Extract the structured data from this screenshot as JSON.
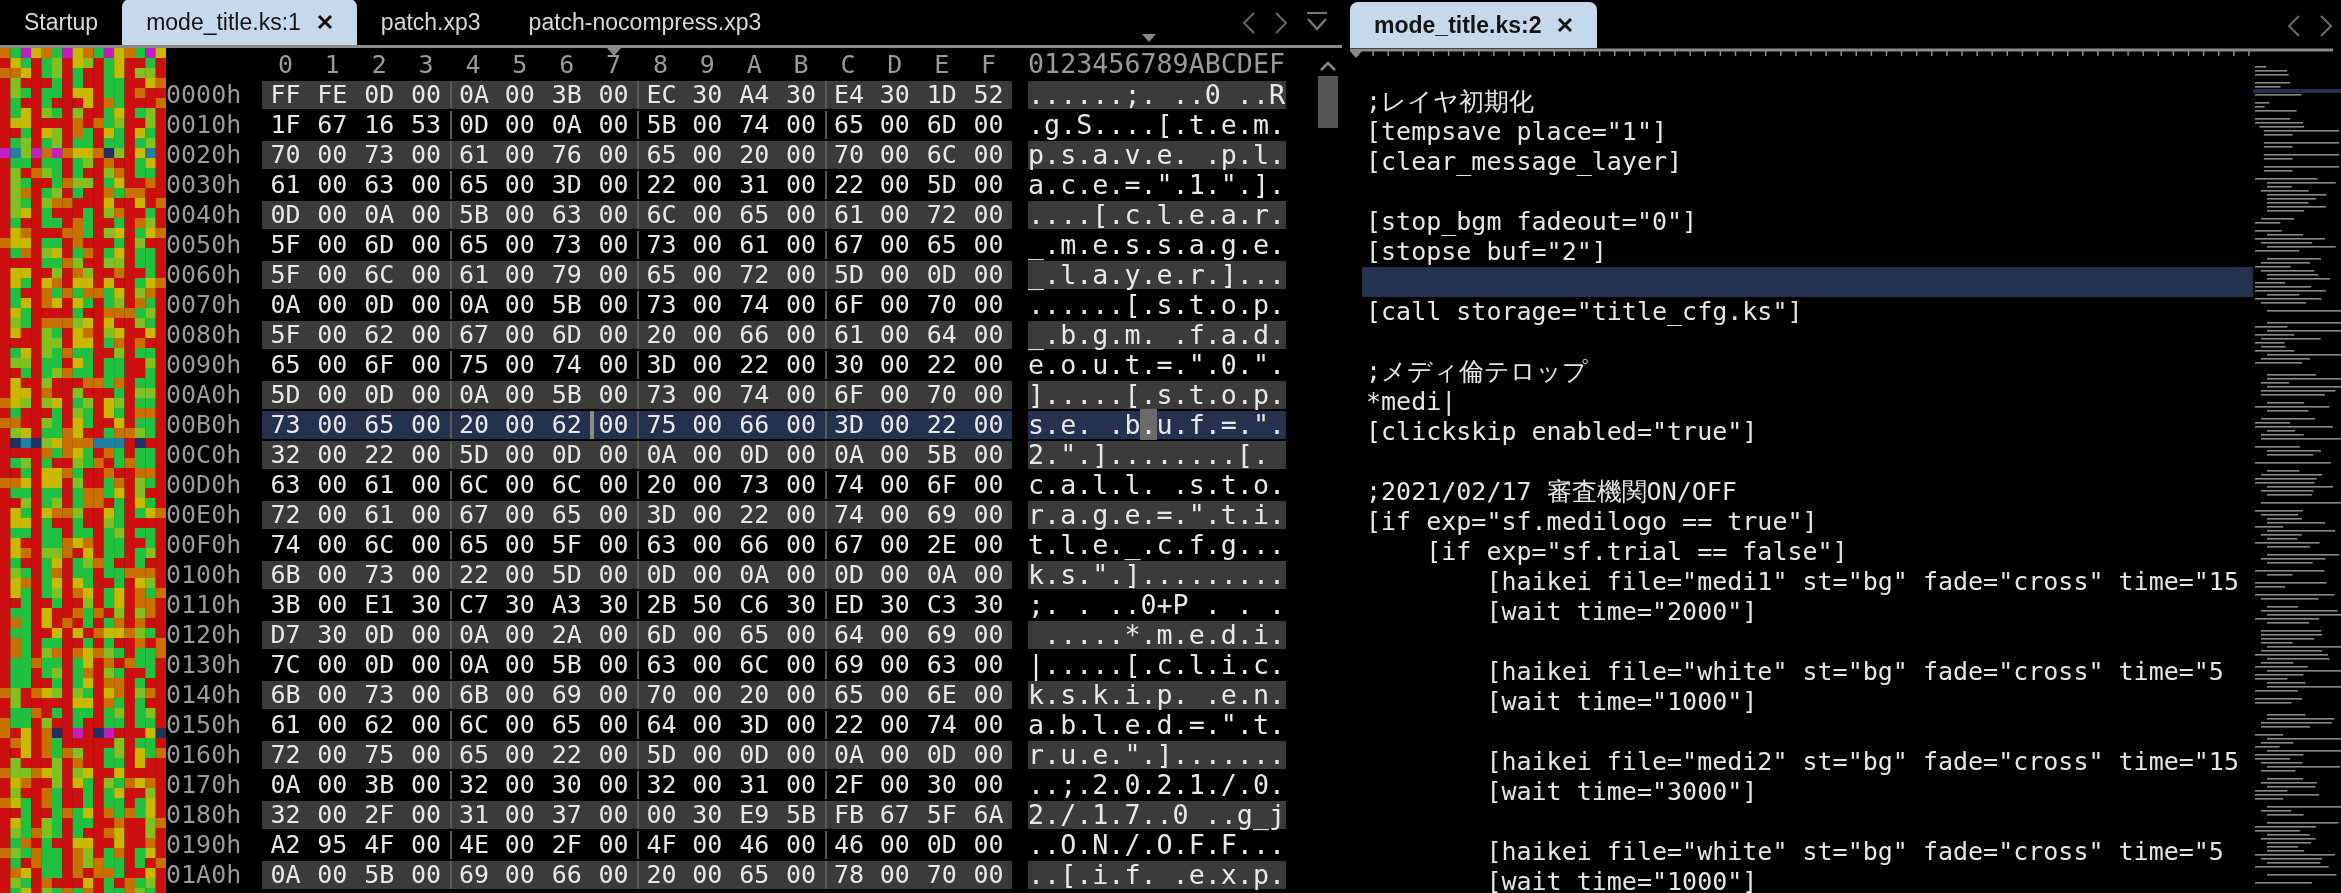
{
  "left_pane": {
    "focused": false,
    "tabs": [
      {
        "label": "Startup",
        "selected": false
      },
      {
        "label": "mode_title.ks:1",
        "selected": true
      },
      {
        "label": "patch.xp3",
        "selected": false
      },
      {
        "label": "patch-nocompress.xp3",
        "selected": false
      }
    ],
    "hex_view": {
      "columns": [
        {
          "label": "0",
          "cursor": false
        },
        {
          "label": "1",
          "cursor": false
        },
        {
          "label": "2",
          "cursor": false
        },
        {
          "label": "3",
          "cursor": false
        },
        {
          "label": "4",
          "cursor": false
        },
        {
          "label": "5",
          "cursor": false
        },
        {
          "label": "6",
          "cursor": false
        },
        {
          "label": "7",
          "cursor": true
        },
        {
          "label": "8",
          "cursor": false
        },
        {
          "label": "9",
          "cursor": false
        },
        {
          "label": "A",
          "cursor": false
        },
        {
          "label": "B",
          "cursor": false
        },
        {
          "label": "C",
          "cursor": false
        },
        {
          "label": "D",
          "cursor": false
        },
        {
          "label": "E",
          "cursor": false
        },
        {
          "label": "F",
          "cursor": false
        }
      ],
      "ascii_header": "0123456789ABCDEF",
      "rows": [
        {
          "offset": "0000h",
          "bytes": [
            "FF",
            "FE",
            "0D",
            "00",
            "0A",
            "00",
            "3B",
            "00",
            "EC",
            "30",
            "A4",
            "30",
            "E4",
            "30",
            "1D",
            "52"
          ],
          "ascii": "......;. ..0 ..R",
          "selected": false
        },
        {
          "offset": "0010h",
          "bytes": [
            "1F",
            "67",
            "16",
            "53",
            "0D",
            "00",
            "0A",
            "00",
            "5B",
            "00",
            "74",
            "00",
            "65",
            "00",
            "6D",
            "00"
          ],
          "ascii": ".g.S....[.t.e.m.",
          "selected": false
        },
        {
          "offset": "0020h",
          "bytes": [
            "70",
            "00",
            "73",
            "00",
            "61",
            "00",
            "76",
            "00",
            "65",
            "00",
            "20",
            "00",
            "70",
            "00",
            "6C",
            "00"
          ],
          "ascii": "p.s.a.v.e. .p.l.",
          "selected": false
        },
        {
          "offset": "0030h",
          "bytes": [
            "61",
            "00",
            "63",
            "00",
            "65",
            "00",
            "3D",
            "00",
            "22",
            "00",
            "31",
            "00",
            "22",
            "00",
            "5D",
            "00"
          ],
          "ascii": "a.c.e.=.\".1.\".].",
          "selected": false
        },
        {
          "offset": "0040h",
          "bytes": [
            "0D",
            "00",
            "0A",
            "00",
            "5B",
            "00",
            "63",
            "00",
            "6C",
            "00",
            "65",
            "00",
            "61",
            "00",
            "72",
            "00"
          ],
          "ascii": "....[.c.l.e.a.r.",
          "selected": false
        },
        {
          "offset": "0050h",
          "bytes": [
            "5F",
            "00",
            "6D",
            "00",
            "65",
            "00",
            "73",
            "00",
            "73",
            "00",
            "61",
            "00",
            "67",
            "00",
            "65",
            "00"
          ],
          "ascii": "_.m.e.s.s.a.g.e.",
          "selected": false
        },
        {
          "offset": "0060h",
          "bytes": [
            "5F",
            "00",
            "6C",
            "00",
            "61",
            "00",
            "79",
            "00",
            "65",
            "00",
            "72",
            "00",
            "5D",
            "00",
            "0D",
            "00"
          ],
          "ascii": "_.l.a.y.e.r.]...",
          "selected": false
        },
        {
          "offset": "0070h",
          "bytes": [
            "0A",
            "00",
            "0D",
            "00",
            "0A",
            "00",
            "5B",
            "00",
            "73",
            "00",
            "74",
            "00",
            "6F",
            "00",
            "70",
            "00"
          ],
          "ascii": "......[.s.t.o.p.",
          "selected": false
        },
        {
          "offset": "0080h",
          "bytes": [
            "5F",
            "00",
            "62",
            "00",
            "67",
            "00",
            "6D",
            "00",
            "20",
            "00",
            "66",
            "00",
            "61",
            "00",
            "64",
            "00"
          ],
          "ascii": "_.b.g.m. .f.a.d.",
          "selected": false
        },
        {
          "offset": "0090h",
          "bytes": [
            "65",
            "00",
            "6F",
            "00",
            "75",
            "00",
            "74",
            "00",
            "3D",
            "00",
            "22",
            "00",
            "30",
            "00",
            "22",
            "00"
          ],
          "ascii": "e.o.u.t.=.\".0.\".",
          "selected": false
        },
        {
          "offset": "00A0h",
          "bytes": [
            "5D",
            "00",
            "0D",
            "00",
            "0A",
            "00",
            "5B",
            "00",
            "73",
            "00",
            "74",
            "00",
            "6F",
            "00",
            "70",
            "00"
          ],
          "ascii": "].....[.s.t.o.p.",
          "selected": false
        },
        {
          "offset": "00B0h",
          "bytes": [
            "73",
            "00",
            "65",
            "00",
            "20",
            "00",
            "62",
            "00",
            "75",
            "00",
            "66",
            "00",
            "3D",
            "00",
            "22",
            "00"
          ],
          "ascii": "s.e. .b.u.f.=.\".",
          "selected": true
        },
        {
          "offset": "00C0h",
          "bytes": [
            "32",
            "00",
            "22",
            "00",
            "5D",
            "00",
            "0D",
            "00",
            "0A",
            "00",
            "0D",
            "00",
            "0A",
            "00",
            "5B",
            "00"
          ],
          "ascii": "2.\".]........[.",
          "selected": false
        },
        {
          "offset": "00D0h",
          "bytes": [
            "63",
            "00",
            "61",
            "00",
            "6C",
            "00",
            "6C",
            "00",
            "20",
            "00",
            "73",
            "00",
            "74",
            "00",
            "6F",
            "00"
          ],
          "ascii": "c.a.l.l. .s.t.o.",
          "selected": false
        },
        {
          "offset": "00E0h",
          "bytes": [
            "72",
            "00",
            "61",
            "00",
            "67",
            "00",
            "65",
            "00",
            "3D",
            "00",
            "22",
            "00",
            "74",
            "00",
            "69",
            "00"
          ],
          "ascii": "r.a.g.e.=.\".t.i.",
          "selected": false
        },
        {
          "offset": "00F0h",
          "bytes": [
            "74",
            "00",
            "6C",
            "00",
            "65",
            "00",
            "5F",
            "00",
            "63",
            "00",
            "66",
            "00",
            "67",
            "00",
            "2E",
            "00"
          ],
          "ascii": "t.l.e._.c.f.g...",
          "selected": false
        },
        {
          "offset": "0100h",
          "bytes": [
            "6B",
            "00",
            "73",
            "00",
            "22",
            "00",
            "5D",
            "00",
            "0D",
            "00",
            "0A",
            "00",
            "0D",
            "00",
            "0A",
            "00"
          ],
          "ascii": "k.s.\".].........",
          "selected": false
        },
        {
          "offset": "0110h",
          "bytes": [
            "3B",
            "00",
            "E1",
            "30",
            "C7",
            "30",
            "A3",
            "30",
            "2B",
            "50",
            "C6",
            "30",
            "ED",
            "30",
            "C3",
            "30"
          ],
          "ascii": ";. . ..0+P . . .",
          "selected": false
        },
        {
          "offset": "0120h",
          "bytes": [
            "D7",
            "30",
            "0D",
            "00",
            "0A",
            "00",
            "2A",
            "00",
            "6D",
            "00",
            "65",
            "00",
            "64",
            "00",
            "69",
            "00"
          ],
          "ascii": " .....*.m.e.d.i.",
          "selected": false
        },
        {
          "offset": "0130h",
          "bytes": [
            "7C",
            "00",
            "0D",
            "00",
            "0A",
            "00",
            "5B",
            "00",
            "63",
            "00",
            "6C",
            "00",
            "69",
            "00",
            "63",
            "00"
          ],
          "ascii": "|.....[.c.l.i.c.",
          "selected": false
        },
        {
          "offset": "0140h",
          "bytes": [
            "6B",
            "00",
            "73",
            "00",
            "6B",
            "00",
            "69",
            "00",
            "70",
            "00",
            "20",
            "00",
            "65",
            "00",
            "6E",
            "00"
          ],
          "ascii": "k.s.k.i.p. .e.n.",
          "selected": false
        },
        {
          "offset": "0150h",
          "bytes": [
            "61",
            "00",
            "62",
            "00",
            "6C",
            "00",
            "65",
            "00",
            "64",
            "00",
            "3D",
            "00",
            "22",
            "00",
            "74",
            "00"
          ],
          "ascii": "a.b.l.e.d.=.\".t.",
          "selected": false
        },
        {
          "offset": "0160h",
          "bytes": [
            "72",
            "00",
            "75",
            "00",
            "65",
            "00",
            "22",
            "00",
            "5D",
            "00",
            "0D",
            "00",
            "0A",
            "00",
            "0D",
            "00"
          ],
          "ascii": "r.u.e.\".].......",
          "selected": false
        },
        {
          "offset": "0170h",
          "bytes": [
            "0A",
            "00",
            "3B",
            "00",
            "32",
            "00",
            "30",
            "00",
            "32",
            "00",
            "31",
            "00",
            "2F",
            "00",
            "30",
            "00"
          ],
          "ascii": "..;.2.0.2.1./.0.",
          "selected": false
        },
        {
          "offset": "0180h",
          "bytes": [
            "32",
            "00",
            "2F",
            "00",
            "31",
            "00",
            "37",
            "00",
            "00",
            "30",
            "E9",
            "5B",
            "FB",
            "67",
            "5F",
            "6A"
          ],
          "ascii": "2./.1.7..0 ..g_j",
          "selected": false
        },
        {
          "offset": "0190h",
          "bytes": [
            "A2",
            "95",
            "4F",
            "00",
            "4E",
            "00",
            "2F",
            "00",
            "4F",
            "00",
            "46",
            "00",
            "46",
            "00",
            "0D",
            "00"
          ],
          "ascii": "..O.N./.O.F.F...",
          "selected": false
        },
        {
          "offset": "01A0h",
          "bytes": [
            "0A",
            "00",
            "5B",
            "00",
            "69",
            "00",
            "66",
            "00",
            "20",
            "00",
            "65",
            "00",
            "78",
            "00",
            "70",
            "00"
          ],
          "ascii": "..[.i.f. .e.x.p.",
          "selected": false
        }
      ]
    }
  },
  "right_pane": {
    "focused": true,
    "tabs": [
      {
        "label": "mode_title.ks:2",
        "selected": true
      }
    ],
    "code_lines": [
      {
        "kind": "code",
        "text": ";レイヤ初期化",
        "current": false
      },
      {
        "kind": "code",
        "text": "[tempsave place=\"1\"]",
        "current": false
      },
      {
        "kind": "code",
        "text": "[clear_message_layer]",
        "current": false
      },
      {
        "kind": "blank",
        "current": false
      },
      {
        "kind": "code",
        "text": "[stop_bgm fadeout=\"0\"]",
        "current": false
      },
      {
        "kind": "code",
        "text": "[stopse buf=\"2\"]",
        "current": false
      },
      {
        "kind": "blank",
        "current": true
      },
      {
        "kind": "code",
        "text": "[call storage=\"title_cfg.ks\"]",
        "current": false
      },
      {
        "kind": "blank",
        "current": false
      },
      {
        "kind": "code",
        "text": ";メディ倫テロップ",
        "current": false
      },
      {
        "kind": "code",
        "text": "*medi|",
        "current": false
      },
      {
        "kind": "code",
        "text": "[clickskip enabled=\"true\"]",
        "current": false
      },
      {
        "kind": "blank",
        "current": false
      },
      {
        "kind": "code",
        "text": ";2021/02/17 審査機関ON/OFF",
        "current": false
      },
      {
        "kind": "code",
        "text": "[if exp=\"sf.medilogo == true\"]",
        "current": false
      },
      {
        "kind": "code",
        "text": "    [if exp=\"sf.trial == false\"]",
        "current": false
      },
      {
        "kind": "code",
        "text": "        [haikei file=\"medi1\" st=\"bg\" fade=\"cross\" time=\"15",
        "current": false
      },
      {
        "kind": "code",
        "text": "        [wait time=\"2000\"]",
        "current": false
      },
      {
        "kind": "blank",
        "current": false
      },
      {
        "kind": "code",
        "text": "        [haikei file=\"white\" st=\"bg\" fade=\"cross\" time=\"5",
        "current": false
      },
      {
        "kind": "code",
        "text": "        [wait time=\"1000\"]",
        "current": false
      },
      {
        "kind": "blank",
        "current": false
      },
      {
        "kind": "code",
        "text": "        [haikei file=\"medi2\" st=\"bg\" fade=\"cross\" time=\"15",
        "current": false
      },
      {
        "kind": "code",
        "text": "        [wait time=\"3000\"]",
        "current": false
      },
      {
        "kind": "blank",
        "current": false
      },
      {
        "kind": "code",
        "text": "        [haikei file=\"white\" st=\"bg\" fade=\"cross\" time=\"5",
        "current": false
      },
      {
        "kind": "code",
        "text": "        [wait time=\"1000\"]",
        "current": false
      }
    ]
  }
}
